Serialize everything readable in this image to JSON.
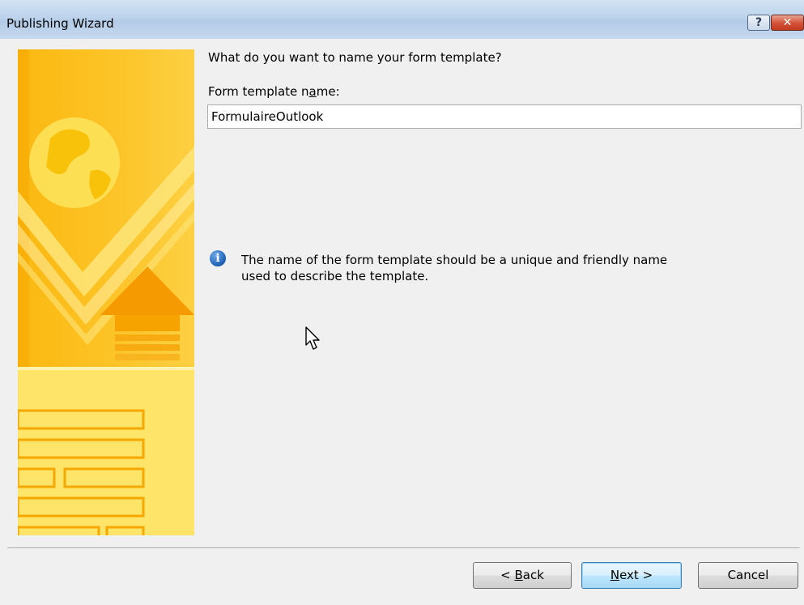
{
  "window": {
    "title": "Publishing Wizard"
  },
  "titlebar": {
    "help_glyph": "?",
    "close_glyph": "✕"
  },
  "content": {
    "question": "What do you want to name your form template?",
    "field_label_pre": "Form template n",
    "field_label_key": "a",
    "field_label_post": "me:",
    "name_value": "FormulaireOutlook",
    "info_text": "The name of the form template should be a unique and friendly name used to describe the template."
  },
  "buttons": {
    "back_pre": "< ",
    "back_key": "B",
    "back_post": "ack",
    "next_key": "N",
    "next_post": "ext >",
    "cancel": "Cancel"
  },
  "colors": {
    "banner_primary": "#fbc11e",
    "banner_dark": "#f5a700",
    "banner_light": "#ffe36a",
    "accent_next": "#3c7fb1"
  },
  "icons": {
    "info": "info-icon",
    "banner": "globe-arrow-form-illustration",
    "cursor": "mouse-pointer-icon"
  }
}
